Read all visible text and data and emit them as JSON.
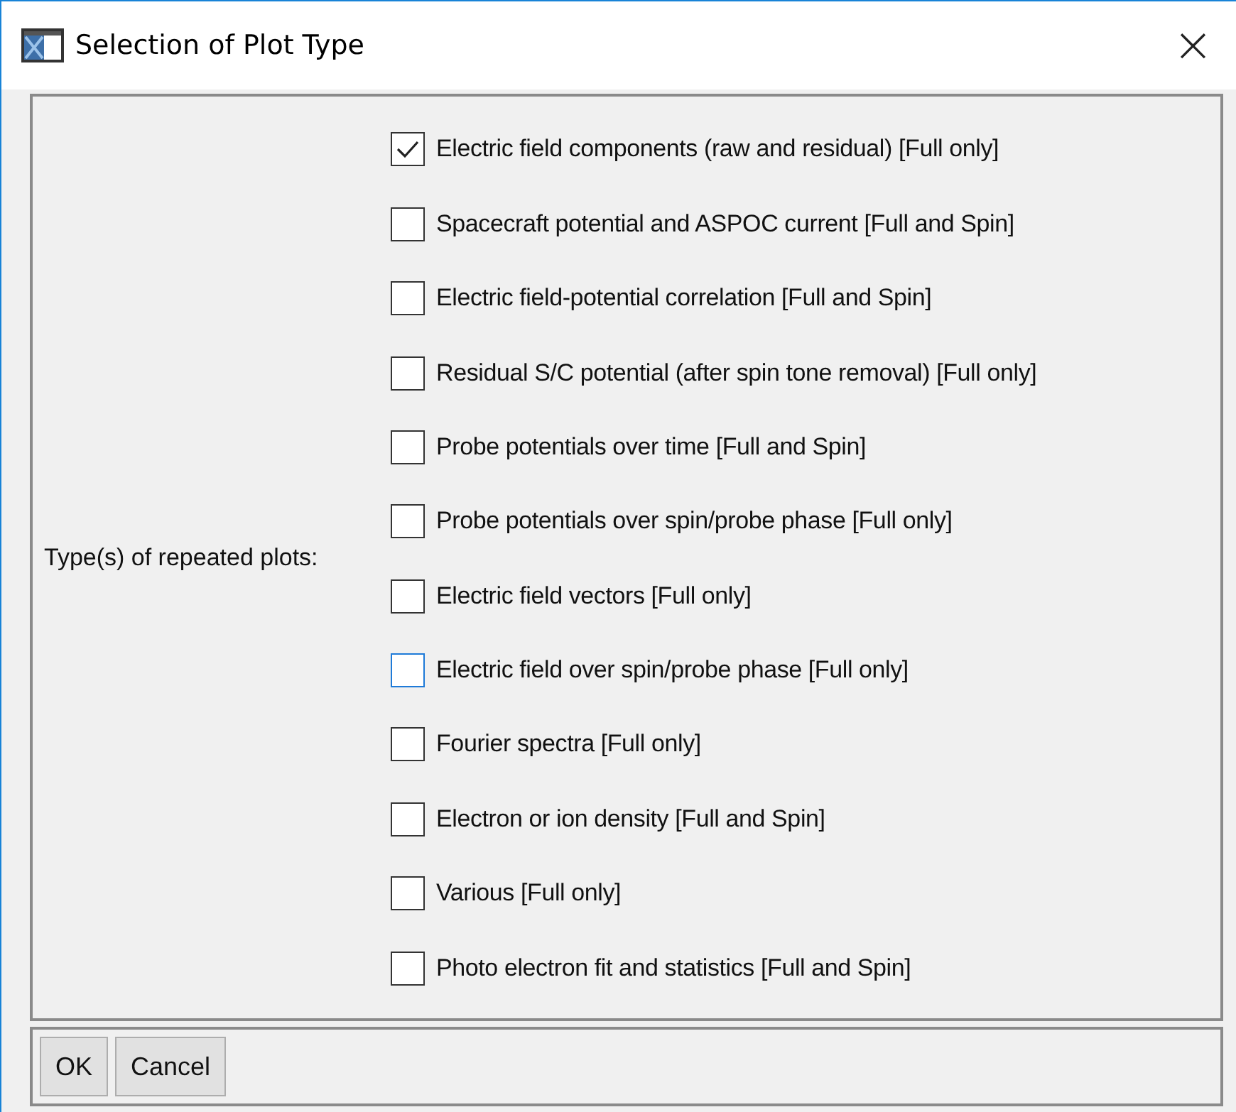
{
  "window": {
    "title": "Selection of Plot Type",
    "close": "×"
  },
  "group_label": "Type(s) of repeated plots:",
  "options": [
    {
      "label": "Electric field components (raw and residual) [Full only]",
      "checked": true,
      "focused": false
    },
    {
      "label": "Spacecraft potential and ASPOC current [Full and Spin]",
      "checked": false,
      "focused": false
    },
    {
      "label": "Electric field-potential correlation [Full and Spin]",
      "checked": false,
      "focused": false
    },
    {
      "label": "Residual S/C potential (after spin tone removal) [Full only]",
      "checked": false,
      "focused": false
    },
    {
      "label": "Probe potentials over time [Full and Spin]",
      "checked": false,
      "focused": false
    },
    {
      "label": "Probe potentials over spin/probe phase [Full only]",
      "checked": false,
      "focused": false
    },
    {
      "label": "Electric field vectors [Full only]",
      "checked": false,
      "focused": false
    },
    {
      "label": "Electric field over spin/probe phase [Full only]",
      "checked": false,
      "focused": true
    },
    {
      "label": "Fourier spectra [Full only]",
      "checked": false,
      "focused": false
    },
    {
      "label": "Electron or ion density [Full and Spin]",
      "checked": false,
      "focused": false
    },
    {
      "label": "Various [Full only]",
      "checked": false,
      "focused": false
    },
    {
      "label": "Photo electron fit and statistics [Full and Spin]",
      "checked": false,
      "focused": false
    }
  ],
  "buttons": [
    "OK",
    "Cancel"
  ]
}
